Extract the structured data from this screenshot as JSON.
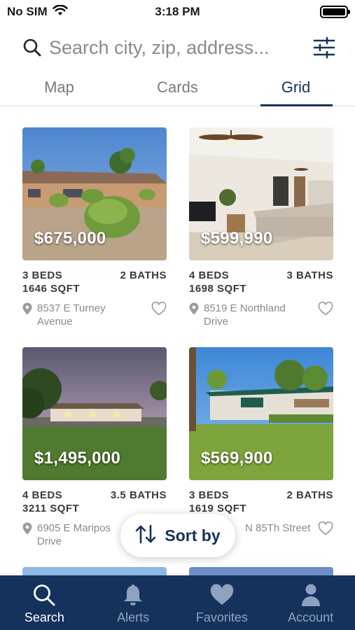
{
  "status_bar": {
    "carrier": "No SIM",
    "time": "3:18 PM"
  },
  "search": {
    "placeholder": "Search city, zip, address..."
  },
  "tabs": [
    {
      "label": "Map",
      "active": false
    },
    {
      "label": "Cards",
      "active": false
    },
    {
      "label": "Grid",
      "active": true
    }
  ],
  "listings": [
    {
      "price": "$675,000",
      "beds": "3 BEDS",
      "baths": "2 BATHS",
      "sqft": "1646 SQFT",
      "address_line1": "8537 E Turney",
      "address_line2": "Avenue"
    },
    {
      "price": "$599,990",
      "beds": "4 BEDS",
      "baths": "3 BATHS",
      "sqft": "1698 SQFT",
      "address_line1": "8519 E Northland",
      "address_line2": "Drive"
    },
    {
      "price": "$1,495,000",
      "beds": "4 BEDS",
      "baths": "3.5 BATHS",
      "sqft": "3211 SQFT",
      "address_line1": "6905 E Maripos",
      "address_line2": "Drive"
    },
    {
      "price": "$569,900",
      "beds": "3 BEDS",
      "baths": "2 BATHS",
      "sqft": "1619 SQFT",
      "address_line1": "N 85Th Street",
      "address_line2": ""
    }
  ],
  "sort": {
    "label": "Sort by"
  },
  "bottom_nav": [
    {
      "label": "Search",
      "icon": "search-icon",
      "active": true
    },
    {
      "label": "Alerts",
      "icon": "bell-icon",
      "active": false
    },
    {
      "label": "Favorites",
      "icon": "heart-icon",
      "active": false
    },
    {
      "label": "Account",
      "icon": "person-icon",
      "active": false
    }
  ],
  "colors": {
    "brand": "#15325c",
    "nav_inactive": "#8fa2c0",
    "muted_text": "#8a8a8a"
  }
}
